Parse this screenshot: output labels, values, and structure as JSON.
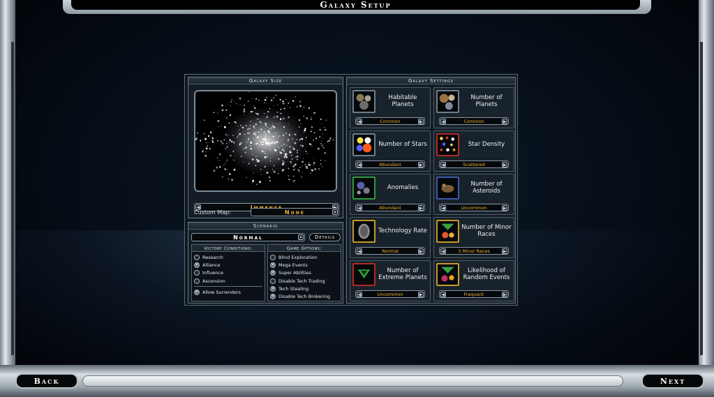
{
  "screen_title": "Galaxy Setup",
  "galaxy_size": {
    "heading": "Galaxy Size",
    "size_value": "Immense",
    "custom_map_label": "Custom Map:",
    "custom_map_value": "None"
  },
  "scenario": {
    "heading": "Scenario",
    "value": "Normal",
    "details_label": "Details",
    "victory": {
      "heading": "Victory Conditions:",
      "items": [
        {
          "label": "Research",
          "checked": false
        },
        {
          "label": "Alliance",
          "checked": true
        },
        {
          "label": "Influence",
          "checked": false
        },
        {
          "label": "Ascension",
          "checked": false
        }
      ],
      "surrender": {
        "label": "Allow Surrenders",
        "checked": true
      }
    },
    "options": {
      "heading": "Game Options:",
      "items": [
        {
          "label": "Blind Exploration",
          "checked": false
        },
        {
          "label": "Mega Events",
          "checked": true
        },
        {
          "label": "Super Abilities",
          "checked": true
        },
        {
          "label": "Disable Tech Trading",
          "checked": false
        },
        {
          "label": "Tech Stealing",
          "checked": true
        },
        {
          "label": "Disable Tech Brokering",
          "checked": true
        }
      ]
    }
  },
  "settings": {
    "heading": "Galaxy Settings",
    "cards": [
      {
        "label": "Habitable Planets",
        "value": "Common",
        "icon": "habitable-planets-icon",
        "border": "default"
      },
      {
        "label": "Number of Planets",
        "value": "Common",
        "icon": "number-of-planets-icon",
        "border": "default"
      },
      {
        "label": "Number of Stars",
        "value": "Abundant",
        "icon": "number-of-stars-icon",
        "border": "default"
      },
      {
        "label": "Star Density",
        "value": "Scattered",
        "icon": "star-density-icon",
        "border": "red"
      },
      {
        "label": "Anomalies",
        "value": "Abundant",
        "icon": "anomalies-icon",
        "border": "green"
      },
      {
        "label": "Number of Asteroids",
        "value": "Uncommon",
        "icon": "asteroids-icon",
        "border": "blue"
      },
      {
        "label": "Technology Rate",
        "value": "Normal",
        "icon": "technology-rate-icon",
        "border": "gold"
      },
      {
        "label": "Number of Minor Races",
        "value": "3 Minor Races",
        "icon": "minor-races-icon",
        "border": "gold"
      },
      {
        "label": "Number of Extreme Planets",
        "value": "Uncommon",
        "icon": "extreme-planets-icon",
        "border": "red"
      },
      {
        "label": "Likelihood of Random Events",
        "value": "Frequent",
        "icon": "random-events-icon",
        "border": "gold"
      }
    ]
  },
  "nav": {
    "back_label": "Back",
    "next_label": "Next"
  },
  "colors": {
    "value_text": "#f0b030",
    "panel_bg": "#141d25",
    "frame_metal": "#c3cbd1"
  }
}
